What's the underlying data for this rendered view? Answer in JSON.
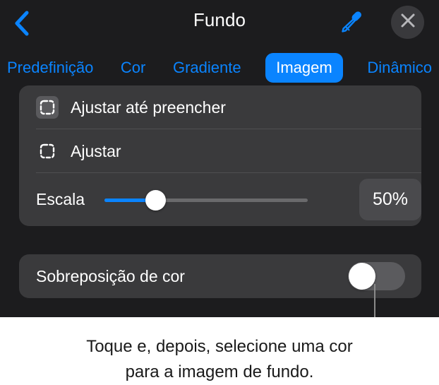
{
  "header": {
    "title": "Fundo",
    "back_icon": "chevron-left-icon",
    "eyedropper_icon": "eyedropper-icon",
    "close_icon": "close-icon",
    "accent_color": "#0a84ff"
  },
  "tabs": [
    {
      "label": "Predefinição",
      "active": false
    },
    {
      "label": "Cor",
      "active": false
    },
    {
      "label": "Gradiente",
      "active": false
    },
    {
      "label": "Imagem",
      "active": true
    },
    {
      "label": "Dinâmico",
      "active": false
    }
  ],
  "image_card": {
    "rows": [
      {
        "label": "Ajustar até preencher",
        "icon": "fit-fill-icon",
        "selected": true
      },
      {
        "label": "Ajustar",
        "icon": "fit-icon",
        "selected": false
      }
    ],
    "scale": {
      "label": "Escala",
      "value_label": "50%",
      "value_percent": 50,
      "slider_position_percent": 25
    }
  },
  "overlay_card": {
    "label": "Sobreposição de cor",
    "toggle_state": "off",
    "toggle_name": "color-overlay-toggle"
  },
  "caption": {
    "line1": "Toque e, depois, selecione uma cor",
    "line2": "para a imagem de fundo."
  },
  "colors": {
    "panel_background": "#1c1c1e",
    "card_background": "#3a3a3c",
    "accent": "#0a84ff",
    "text_primary": "#ffffff",
    "caption_background": "#ffffff",
    "caption_text": "#1a1a1a",
    "callout_line": "#8a8a8a"
  }
}
